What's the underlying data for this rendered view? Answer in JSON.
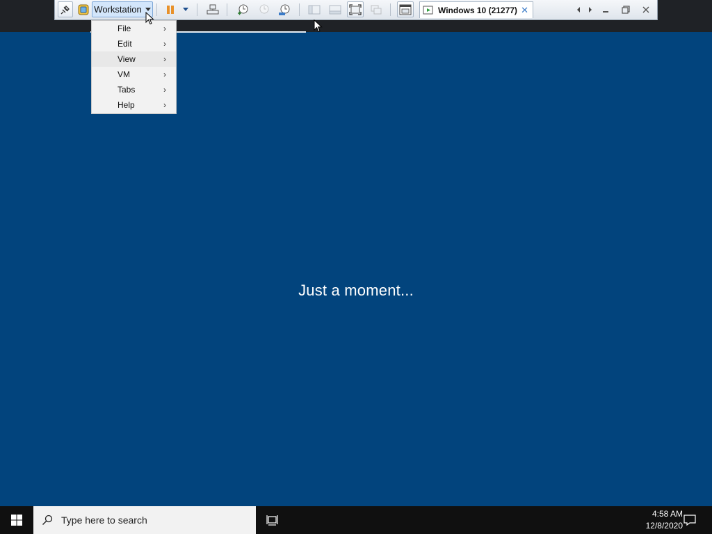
{
  "toolbar": {
    "workstation_label": "Workstation",
    "tab_title": "Windows 10 (21277)",
    "tab_close": "✕",
    "icons": [
      "pin-icon",
      "vm-thumbnail-icon",
      "pause-icon",
      "power-dropdown-icon",
      "network-icon",
      "snapshot-take-icon",
      "snapshot-revert-icon",
      "snapshot-manager-icon",
      "library-icon",
      "thumbnail-bar-icon",
      "fullscreen-icon",
      "unity-icon",
      "console-view-icon",
      "prev-tab-icon",
      "next-tab-icon",
      "minimize-icon",
      "restore-icon",
      "close-icon"
    ]
  },
  "menu": {
    "items": [
      {
        "label": "File",
        "arrow": "›"
      },
      {
        "label": "Edit",
        "arrow": "›"
      },
      {
        "label": "View",
        "arrow": "›"
      },
      {
        "label": "VM",
        "arrow": "›"
      },
      {
        "label": "Tabs",
        "arrow": "›"
      },
      {
        "label": "Help",
        "arrow": "›"
      }
    ],
    "highlighted_item": "View"
  },
  "guest": {
    "status_text": "Just a moment..."
  },
  "taskbar": {
    "search_placeholder": "Type here to search",
    "time": "4:58 AM",
    "date": "12/8/2020"
  },
  "colors": {
    "guest_background": "#02447d",
    "taskbar": "#101010",
    "toolbar_accent": "#3b7bc7",
    "pause_orange": "#e8912a"
  }
}
